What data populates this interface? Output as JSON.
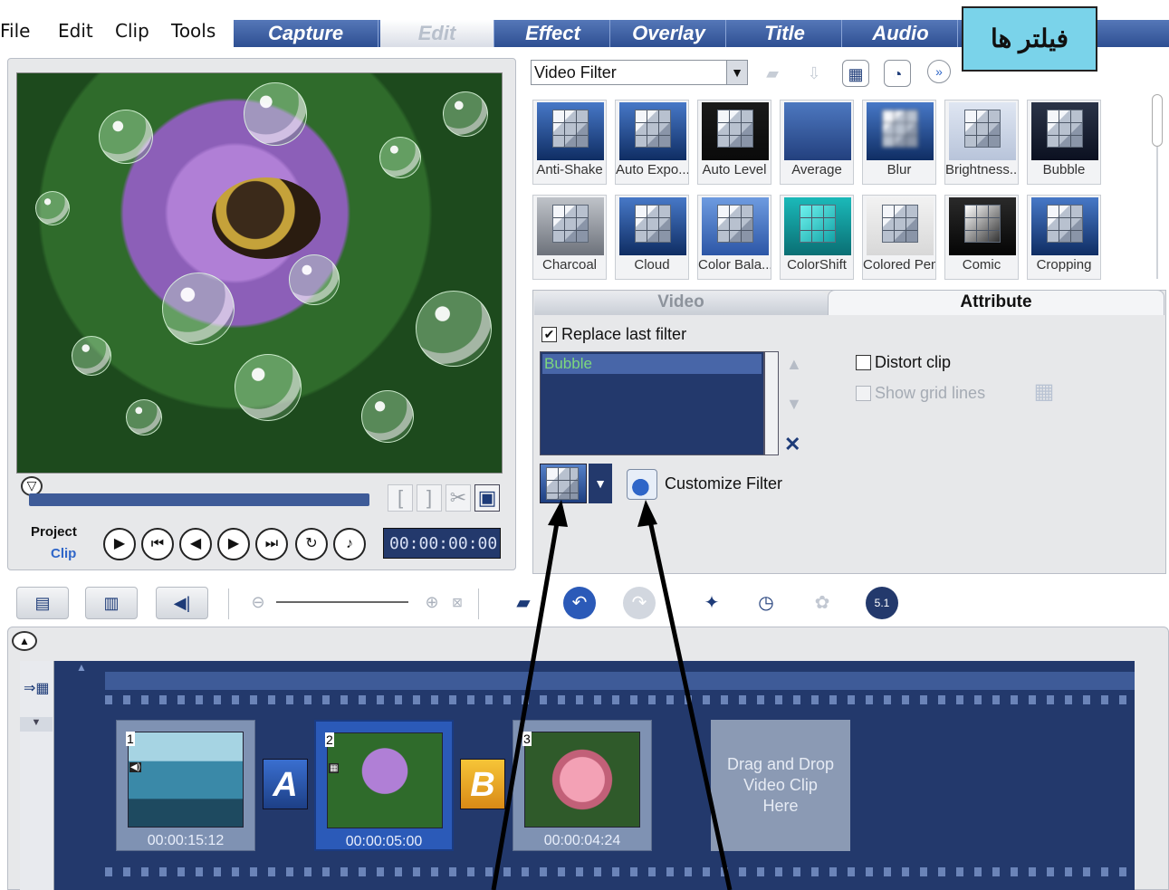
{
  "menu": {
    "items": [
      "File",
      "Edit",
      "Clip",
      "Tools"
    ],
    "tabs": [
      "Capture",
      "Edit",
      "Effect",
      "Overlay",
      "Title",
      "Audio"
    ]
  },
  "callout": {
    "text": "فیلتر ها"
  },
  "library": {
    "dropdown_value": "Video Filter",
    "filters": [
      {
        "label": "Anti-Shake"
      },
      {
        "label": "Auto Expo..."
      },
      {
        "label": "Auto Level"
      },
      {
        "label": "Average"
      },
      {
        "label": "Blur"
      },
      {
        "label": "Brightness..."
      },
      {
        "label": "Bubble"
      },
      {
        "label": "Charcoal"
      },
      {
        "label": "Cloud"
      },
      {
        "label": "Color Bala..."
      },
      {
        "label": "ColorShift"
      },
      {
        "label": "Colored Pen"
      },
      {
        "label": "Comic"
      },
      {
        "label": "Cropping"
      }
    ]
  },
  "options": {
    "tab_video": "Video",
    "tab_attribute": "Attribute",
    "replace_last_filter": "Replace last filter",
    "applied_filter": "Bubble",
    "distort_clip": "Distort clip",
    "show_grid_lines": "Show grid lines",
    "customize_filter": "Customize Filter"
  },
  "preview": {
    "project_label": "Project",
    "clip_label": "Clip",
    "timecode": "00:00:00:00",
    "mark_in": "[",
    "mark_out": "]"
  },
  "timeline": {
    "clips": [
      {
        "number": "1",
        "duration": "00:00:15:12"
      },
      {
        "number": "2",
        "duration": "00:00:05:00"
      },
      {
        "number": "3",
        "duration": "00:00:04:24"
      }
    ],
    "transitions": [
      "A",
      "B"
    ],
    "drop_zone": [
      "Drag and Drop",
      "Video Clip",
      "Here"
    ]
  },
  "colors": {
    "tab_blue": "#2e4f92",
    "callout_bg": "#7ad3ea",
    "timeline_bg": "#23396c",
    "selected_clip": "#2b5ab8"
  }
}
